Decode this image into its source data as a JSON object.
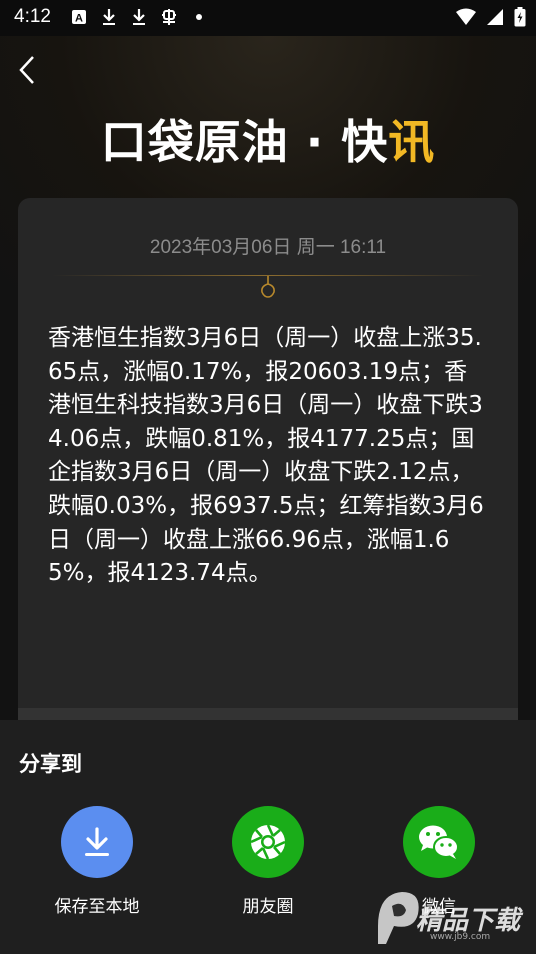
{
  "status_bar": {
    "time": "4:12",
    "left_icons": [
      "a-icon",
      "download-icon",
      "download-icon",
      "bug-icon",
      "dot-icon"
    ],
    "right_icons": [
      "wifi-icon",
      "signal-icon",
      "battery-icon"
    ]
  },
  "header": {
    "back_icon": "back-arrow-icon",
    "brand_main": "口袋原油 · 快讯",
    "brand_accent_color": "#f2b824"
  },
  "article": {
    "datetime": "2023年03月06日 周一 16:11",
    "body": "香港恒生指数3月6日（周一）收盘上涨35.65点，涨幅0.17%，报20603.19点；香港恒生科技指数3月6日（周一）收盘下跌34.06点，跌幅0.81%，报4177.25点；国企指数3月6日（周一）收盘下跌2.12点，跌幅0.03%，报6937.5点；红筹指数3月6日（周一）收盘上涨66.96点，涨幅1.65%，报4123.74点。"
  },
  "share_sheet": {
    "title": "分享到",
    "items": [
      {
        "label": "保存至本地",
        "icon": "download-icon",
        "color": "#5b8ef0"
      },
      {
        "label": "朋友圈",
        "icon": "moments-icon",
        "color": "#1aad19"
      },
      {
        "label": "微信",
        "icon": "wechat-icon",
        "color": "#1aad19"
      }
    ]
  },
  "watermark": {
    "text": "精品下载",
    "sub": "www.jb9.com"
  }
}
